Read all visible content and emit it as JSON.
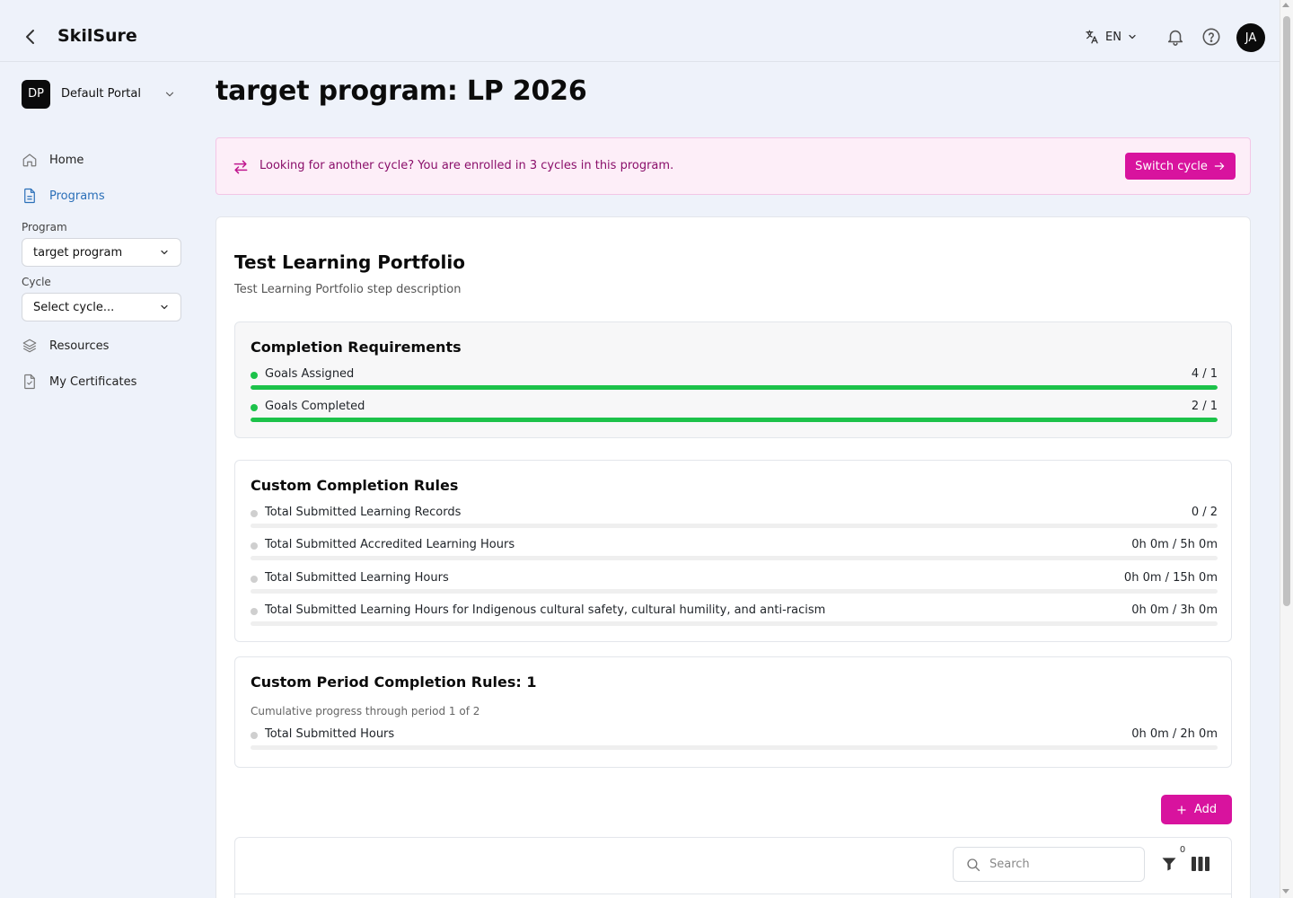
{
  "header": {
    "brand": "SkilSure",
    "language": "EN",
    "avatar_initials": "JA"
  },
  "sidebar": {
    "portal": {
      "initials": "DP",
      "name": "Default Portal"
    },
    "nav": [
      {
        "label": "Home",
        "icon": "home-icon"
      },
      {
        "label": "Programs",
        "icon": "document-icon",
        "active": true
      },
      {
        "label": "Resources",
        "icon": "layers-icon"
      },
      {
        "label": "My Certificates",
        "icon": "certificate-icon"
      }
    ],
    "program_label": "Program",
    "program_value": "target program",
    "cycle_label": "Cycle",
    "cycle_value": "Select cycle..."
  },
  "main": {
    "title": "target program: LP 2026",
    "banner": {
      "text": "Looking for another cycle? You are enrolled in 3 cycles in this program.",
      "button": "Switch cycle"
    },
    "card": {
      "title": "Test Learning Portfolio",
      "description": "Test Learning Portfolio step description",
      "completion_requirements": {
        "title": "Completion Requirements",
        "items": [
          {
            "label": "Goals Assigned",
            "value": "4 / 1",
            "progress": 1.0
          },
          {
            "label": "Goals Completed",
            "value": "2 / 1",
            "progress": 1.0
          }
        ]
      },
      "custom_rules": {
        "title": "Custom Completion Rules",
        "items": [
          {
            "label": "Total Submitted Learning Records",
            "value": "0 / 2",
            "progress": 0
          },
          {
            "label": "Total Submitted Accredited Learning Hours",
            "value": "0h 0m / 5h 0m",
            "progress": 0
          },
          {
            "label": "Total Submitted Learning Hours",
            "value": "0h 0m / 15h 0m",
            "progress": 0
          },
          {
            "label": "Total Submitted Learning Hours for Indigenous cultural safety, cultural humility, and anti-racism",
            "value": "0h 0m / 3h 0m",
            "progress": 0
          }
        ]
      },
      "period_rules": {
        "title": "Custom Period Completion Rules: 1",
        "subtitle": "Cumulative progress through period 1 of 2",
        "items": [
          {
            "label": "Total Submitted Hours",
            "value": "0h 0m / 2h 0m",
            "progress": 0
          }
        ]
      },
      "add_button": "Add",
      "search_placeholder": "Search",
      "filter_count": "0"
    }
  },
  "colors": {
    "accent": "#d8139e",
    "progress_complete": "#1cc24a",
    "dot_complete": "#1cc24a",
    "dot_pending": "#cfcfcf",
    "nav_active": "#2a6fb8"
  }
}
